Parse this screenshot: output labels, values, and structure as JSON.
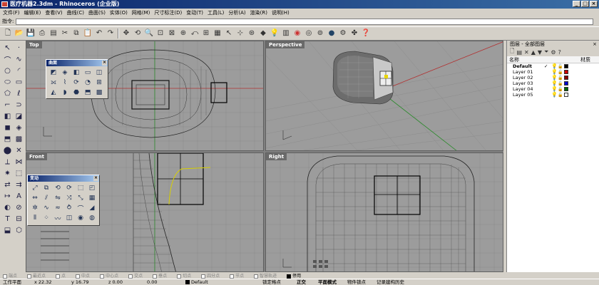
{
  "window": {
    "title": "医疗机器2.3dm - Rhinoceros (企业版)",
    "buttons": [
      "_",
      "□",
      "×"
    ]
  },
  "menu": [
    "文件(F)",
    "编辑(E)",
    "查看(V)",
    "曲线(C)",
    "曲面(S)",
    "实体(O)",
    "网格(M)",
    "尺寸标注(D)",
    "变动(T)",
    "工具(L)",
    "分析(A)",
    "渲染(R)",
    "说明(H)"
  ],
  "command": {
    "label": "指令:",
    "value": ""
  },
  "viewports": {
    "top": "Top",
    "perspective": "Perspective",
    "front": "Front",
    "right": "Right"
  },
  "panels": {
    "surface": {
      "title": "曲面"
    },
    "transform": {
      "title": "变动"
    }
  },
  "layers": {
    "title": "图层 - 全部图层",
    "col_name": "名称",
    "col_material": "材质",
    "rows": [
      {
        "name": "Default",
        "current": "✓",
        "color": "#000000"
      },
      {
        "name": "Layer 01",
        "current": "",
        "color": "#cc0000"
      },
      {
        "name": "Layer 02",
        "current": "",
        "color": "#8b0000"
      },
      {
        "name": "Layer 03",
        "current": "",
        "color": "#0000cc"
      },
      {
        "name": "Layer 04",
        "current": "",
        "color": "#006400"
      },
      {
        "name": "Layer 05",
        "current": "",
        "color": "#ffffff"
      }
    ]
  },
  "osnap": [
    {
      "label": "端点",
      "on": false
    },
    {
      "label": "最近点",
      "on": false
    },
    {
      "label": "点",
      "on": false
    },
    {
      "label": "中点",
      "on": false
    },
    {
      "label": "中心点",
      "on": false
    },
    {
      "label": "交点",
      "on": false
    },
    {
      "label": "垂点",
      "on": false
    },
    {
      "label": "切点",
      "on": false
    },
    {
      "label": "四分点",
      "on": false
    },
    {
      "label": "节点",
      "on": false
    },
    {
      "label": "智慧轨迹",
      "on": false
    },
    {
      "label": "停用",
      "on": true
    }
  ],
  "status": {
    "cplane": "工作平面",
    "x": "x 22.32",
    "y": "y 16.79",
    "z": "z 0.00",
    "dist": "0.00",
    "layer": "Default",
    "grid_snap": "锁定格点",
    "ortho": "正交",
    "planar": "平面模式",
    "osnap": "物件锁点",
    "history": "记录建构历史"
  }
}
